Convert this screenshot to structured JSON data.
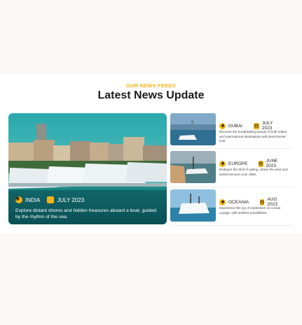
{
  "header": {
    "kicker": "OUR NEWS FEEDS",
    "title": "Latest News Update"
  },
  "featured": {
    "location": "INDIA",
    "date": "JULY 2023",
    "description": "Explore distant shores and hidden treasures aboard a boat, guided by the rhythm of the sea.",
    "location_icon": "map-pin-icon",
    "date_icon": "calendar-icon"
  },
  "news": [
    {
      "location": "DUBAI",
      "date": "JULY 2023",
      "description": "Discover the breathtaking beauty of both Indian and international destinations with Boat Rental Hub"
    },
    {
      "location": "EUROPE",
      "date": "JUNE 2023",
      "description": "Embrace the thrill of sailing, where the wind and waves become your allies."
    },
    {
      "location": "OCEANIA",
      "date": "AUG 2023",
      "description": "Experience the joy of exploration on a boat voyage, with endless possibilities."
    }
  ],
  "colors": {
    "accent": "#f2b418",
    "water": "#1c8f96"
  }
}
